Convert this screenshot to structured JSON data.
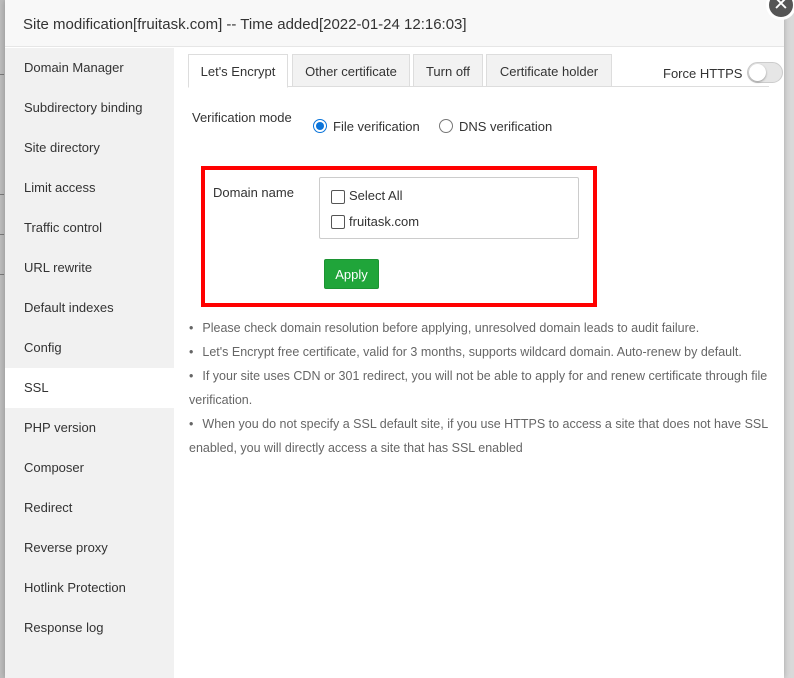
{
  "dialog": {
    "title": "Site modification[fruitask.com] -- Time added[2022-01-24 12:16:03]",
    "close_icon": "close-icon"
  },
  "sidebar": {
    "items": [
      {
        "label": "Domain Manager"
      },
      {
        "label": "Subdirectory binding"
      },
      {
        "label": "Site directory"
      },
      {
        "label": "Limit access"
      },
      {
        "label": "Traffic control"
      },
      {
        "label": "URL rewrite"
      },
      {
        "label": "Default indexes"
      },
      {
        "label": "Config"
      },
      {
        "label": "SSL",
        "active": true
      },
      {
        "label": "PHP version"
      },
      {
        "label": "Composer"
      },
      {
        "label": "Redirect"
      },
      {
        "label": "Reverse proxy"
      },
      {
        "label": "Hotlink Protection"
      },
      {
        "label": "Response log"
      }
    ]
  },
  "tabs": [
    {
      "label": "Let's Encrypt",
      "active": true
    },
    {
      "label": "Other certificate"
    },
    {
      "label": "Turn off"
    },
    {
      "label": "Certificate holder"
    }
  ],
  "force_https": {
    "label": "Force HTTPS",
    "enabled": false
  },
  "verification": {
    "label": "Verification mode",
    "options": [
      {
        "label": "File verification",
        "checked": true
      },
      {
        "label": "DNS verification",
        "checked": false
      }
    ]
  },
  "domain": {
    "label": "Domain name",
    "select_all": "Select All",
    "items": [
      "fruitask.com"
    ]
  },
  "apply_label": "Apply",
  "notes": [
    "Please check domain resolution before applying, unresolved domain leads to audit failure.",
    "Let's Encrypt free certificate, valid for 3 months, supports wildcard domain. Auto-renew by default.",
    "If your site uses CDN or 301 redirect, you will not be able to apply for and renew certificate through file verification.",
    "When you do not specify a SSL default site, if you use HTTPS to access a site that does not have SSL enabled, you will directly access a site that has SSL enabled"
  ],
  "colors": {
    "accent_green": "#20a53a",
    "radio_blue": "#0a74da",
    "highlight_red": "#ff0000"
  }
}
